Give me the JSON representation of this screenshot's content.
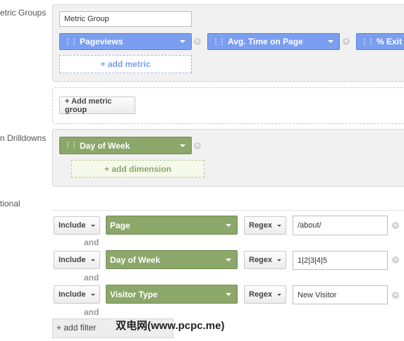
{
  "sections": {
    "metric_groups_label": "etric Groups",
    "drilldowns_label": "n Drilldowns",
    "optional_label": "tional"
  },
  "metric_group": {
    "name_value": "Metric Group",
    "metrics": [
      "Pageviews",
      "Avg. Time on Page",
      "% Exit"
    ],
    "add_metric": "+ add metric",
    "add_metric_group": "+ Add metric group"
  },
  "drilldown": {
    "dimension": "Day of Week",
    "add_dimension": "+ add dimension"
  },
  "filters": [
    {
      "include": "Include",
      "dimension": "Page",
      "match": "Regex",
      "value": "/about/"
    },
    {
      "include": "Include",
      "dimension": "Day of Week",
      "match": "Regex",
      "value": "1|2|3|4|5"
    },
    {
      "include": "Include",
      "dimension": "Visitor Type",
      "match": "Regex",
      "value": "New Visitor"
    }
  ],
  "and_label": "and",
  "add_filter": "+ add filter",
  "watermark": "双电网(www.pcpc.me)",
  "colors": {
    "metric_pill": "#7b9ef0",
    "dimension_pill": "#8ca76a"
  }
}
